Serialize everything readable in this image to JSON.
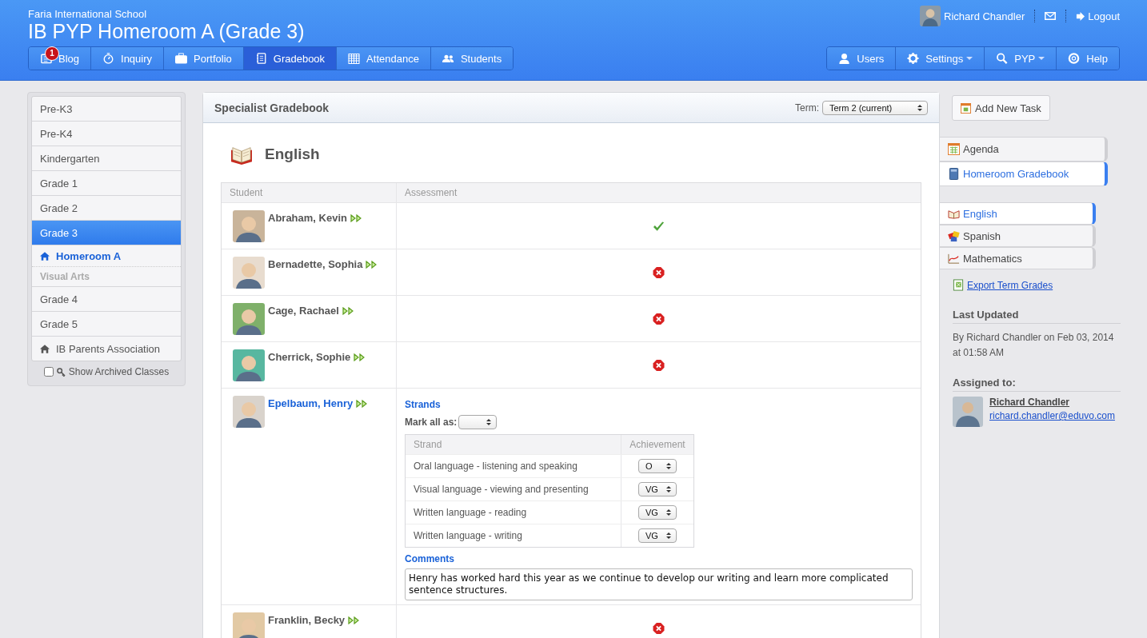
{
  "header": {
    "school": "Faria International School",
    "title": "IB PYP Homeroom A (Grade 3)",
    "user": "Richard Chandler",
    "logout": "Logout",
    "nav_left": [
      {
        "label": "Blog",
        "badge": "1",
        "selected": false
      },
      {
        "label": "Inquiry",
        "selected": false
      },
      {
        "label": "Portfolio",
        "selected": false
      },
      {
        "label": "Gradebook",
        "selected": true
      },
      {
        "label": "Attendance",
        "selected": false
      },
      {
        "label": "Students",
        "selected": false
      }
    ],
    "nav_right": [
      {
        "label": "Users",
        "dropdown": false
      },
      {
        "label": "Settings",
        "dropdown": true
      },
      {
        "label": "PYP",
        "dropdown": true
      },
      {
        "label": "Help",
        "dropdown": false
      }
    ]
  },
  "sidebar": {
    "items": [
      {
        "label": "Pre-K3",
        "kind": "item",
        "selected": false
      },
      {
        "label": "Pre-K4",
        "kind": "item",
        "selected": false
      },
      {
        "label": "Kindergarten",
        "kind": "item",
        "selected": false
      },
      {
        "label": "Grade 1",
        "kind": "item",
        "selected": false
      },
      {
        "label": "Grade 2",
        "kind": "item",
        "selected": false
      },
      {
        "label": "Grade 3",
        "kind": "item",
        "selected": true
      },
      {
        "label": "Homeroom A",
        "kind": "home",
        "selected": true
      },
      {
        "label": "Visual Arts",
        "kind": "sub",
        "selected": false
      },
      {
        "label": "Grade 4",
        "kind": "item",
        "selected": false
      },
      {
        "label": "Grade 5",
        "kind": "item",
        "selected": false
      },
      {
        "label": "IB Parents Association",
        "kind": "home",
        "selected": false
      }
    ],
    "archived": {
      "label": "Show Archived Classes",
      "checked": false
    }
  },
  "main": {
    "title": "Specialist Gradebook",
    "term_label": "Term:",
    "term": "Term 2 (current)",
    "subject": "English",
    "columns": [
      "Student",
      "Assessment"
    ],
    "students": [
      {
        "name": "Abraham, Kevin",
        "kind": "check",
        "selected": false
      },
      {
        "name": "Bernadette, Sophia",
        "kind": "cross",
        "selected": false
      },
      {
        "name": "Cage, Rachael",
        "kind": "cross",
        "selected": false
      },
      {
        "name": "Cherrick, Sophie",
        "kind": "cross",
        "selected": false
      },
      {
        "name": "Epelbaum, Henry",
        "kind": "strands",
        "selected": true
      },
      {
        "name": "Franklin, Becky",
        "kind": "cross",
        "selected": false
      }
    ],
    "detail": {
      "strands_heading": "Strands",
      "mark_all": "Mark all as:",
      "columns": [
        "Strand",
        "Achievement"
      ],
      "strands": [
        {
          "name": "Oral language - listening and speaking",
          "value": "O"
        },
        {
          "name": "Visual language - viewing and presenting",
          "value": "VG"
        },
        {
          "name": "Written language - reading",
          "value": "VG"
        },
        {
          "name": "Written language - writing",
          "value": "VG"
        }
      ],
      "comments_heading": "Comments",
      "comment": "Henry has worked hard this year as we continue to develop our writing and learn more complicated sentence structures."
    }
  },
  "right": {
    "add_task": "Add New Task",
    "tabs": [
      {
        "label": "Agenda",
        "selected": false
      },
      {
        "label": "Homeroom Gradebook",
        "selected": true
      }
    ],
    "subjects": [
      {
        "label": "English",
        "selected": true
      },
      {
        "label": "Spanish",
        "selected": false
      },
      {
        "label": "Mathematics",
        "selected": false
      }
    ],
    "export": "Export Term Grades",
    "last_updated_heading": "Last Updated",
    "last_updated": "By Richard Chandler on Feb 03, 2014 at 01:58 AM",
    "assigned_heading": "Assigned to:",
    "assignee": "Richard Chandler",
    "email": "richard.chandler@eduvo.com"
  }
}
